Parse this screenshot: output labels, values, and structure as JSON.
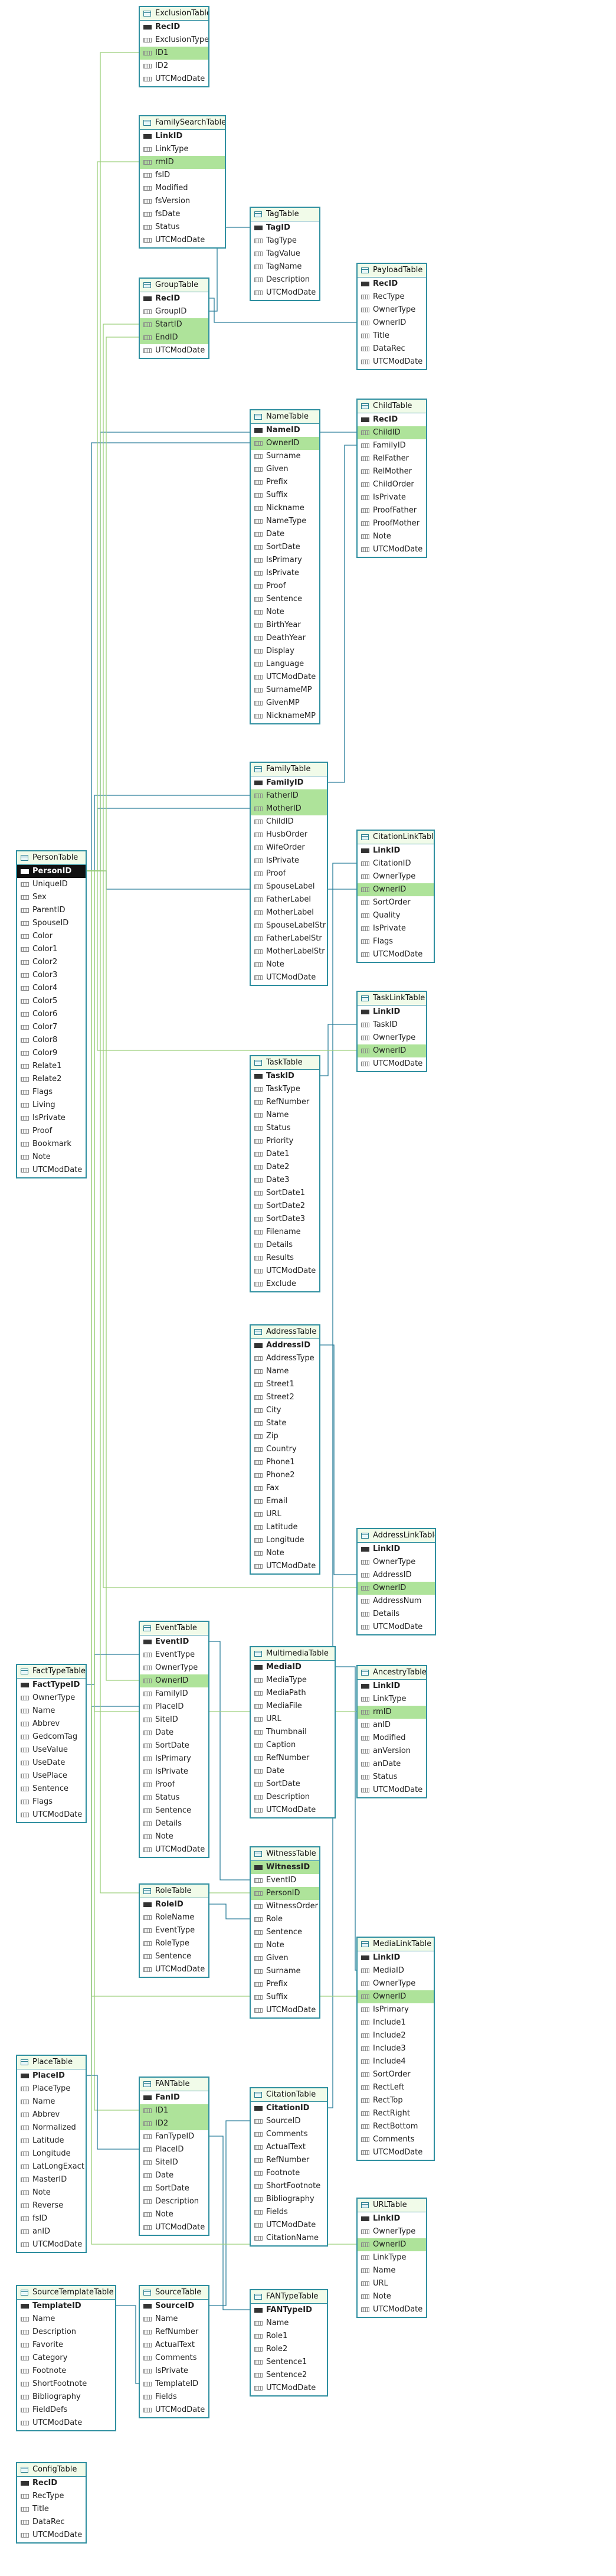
{
  "colors": {
    "border": "#2f8fa0",
    "title_bg": "#f1fbe9",
    "highlight": "#aee39a",
    "selected": "#111111",
    "link_blue": "#2a7e9a",
    "link_green": "#9ccf7a"
  },
  "icons": {
    "table": "table-icon",
    "field": "field-icon",
    "key": "key-icon"
  },
  "tables": [
    {
      "name": "ExclusionTable",
      "fields": [
        "RecID",
        "ExclusionType",
        "ID1",
        "ID2",
        "UTCModDate"
      ],
      "pk": [
        0
      ],
      "hl": [
        2
      ],
      "sel": []
    },
    {
      "name": "FamilySearchTable",
      "fields": [
        "LinkID",
        "LinkType",
        "rmID",
        "fsID",
        "Modified",
        "fsVersion",
        "fsDate",
        "Status",
        "UTCModDate"
      ],
      "pk": [
        0
      ],
      "hl": [
        2
      ],
      "sel": []
    },
    {
      "name": "TagTable",
      "fields": [
        "TagID",
        "TagType",
        "TagValue",
        "TagName",
        "Description",
        "UTCModDate"
      ],
      "pk": [
        0
      ],
      "hl": [],
      "sel": []
    },
    {
      "name": "GroupTable",
      "fields": [
        "RecID",
        "GroupID",
        "StartID",
        "EndID",
        "UTCModDate"
      ],
      "pk": [
        0
      ],
      "hl": [
        2,
        3
      ],
      "sel": []
    },
    {
      "name": "PayloadTable",
      "fields": [
        "RecID",
        "RecType",
        "OwnerType",
        "OwnerID",
        "Title",
        "DataRec",
        "UTCModDate"
      ],
      "pk": [
        0
      ],
      "hl": [],
      "sel": []
    },
    {
      "name": "ChildTable",
      "fields": [
        "RecID",
        "ChildID",
        "FamilyID",
        "RelFather",
        "RelMother",
        "ChildOrder",
        "IsPrivate",
        "ProofFather",
        "ProofMother",
        "Note",
        "UTCModDate"
      ],
      "pk": [
        0
      ],
      "hl": [
        1
      ],
      "sel": []
    },
    {
      "name": "NameTable",
      "fields": [
        "NameID",
        "OwnerID",
        "Surname",
        "Given",
        "Prefix",
        "Suffix",
        "Nickname",
        "NameType",
        "Date",
        "SortDate",
        "IsPrimary",
        "IsPrivate",
        "Proof",
        "Sentence",
        "Note",
        "BirthYear",
        "DeathYear",
        "Display",
        "Language",
        "UTCModDate",
        "SurnameMP",
        "GivenMP",
        "NicknameMP"
      ],
      "pk": [
        0
      ],
      "hl": [
        1
      ],
      "sel": []
    },
    {
      "name": "FamilyTable",
      "fields": [
        "FamilyID",
        "FatherID",
        "MotherID",
        "ChildID",
        "HusbOrder",
        "WifeOrder",
        "IsPrivate",
        "Proof",
        "SpouseLabel",
        "FatherLabel",
        "MotherLabel",
        "SpouseLabelStr",
        "FatherLabelStr",
        "MotherLabelStr",
        "Note",
        "UTCModDate"
      ],
      "pk": [
        0
      ],
      "hl": [
        1,
        2
      ],
      "sel": []
    },
    {
      "name": "PersonTable",
      "fields": [
        "PersonID",
        "UniqueID",
        "Sex",
        "ParentID",
        "SpouseID",
        "Color",
        "Color1",
        "Color2",
        "Color3",
        "Color4",
        "Color5",
        "Color6",
        "Color7",
        "Color8",
        "Color9",
        "Relate1",
        "Relate2",
        "Flags",
        "Living",
        "IsPrivate",
        "Proof",
        "Bookmark",
        "Note",
        "UTCModDate"
      ],
      "pk": [
        0
      ],
      "hl": [],
      "sel": [
        0
      ]
    },
    {
      "name": "CitationLinkTable",
      "fields": [
        "LinkID",
        "CitationID",
        "OwnerType",
        "OwnerID",
        "SortOrder",
        "Quality",
        "IsPrivate",
        "Flags",
        "UTCModDate"
      ],
      "pk": [
        0
      ],
      "hl": [
        3
      ],
      "sel": []
    },
    {
      "name": "TaskLinkTable",
      "fields": [
        "LinkID",
        "TaskID",
        "OwnerType",
        "OwnerID",
        "UTCModDate"
      ],
      "pk": [
        0
      ],
      "hl": [
        3
      ],
      "sel": []
    },
    {
      "name": "TaskTable",
      "fields": [
        "TaskID",
        "TaskType",
        "RefNumber",
        "Name",
        "Status",
        "Priority",
        "Date1",
        "Date2",
        "Date3",
        "SortDate1",
        "SortDate2",
        "SortDate3",
        "Filename",
        "Details",
        "Results",
        "UTCModDate",
        "Exclude"
      ],
      "pk": [
        0
      ],
      "hl": [],
      "sel": []
    },
    {
      "name": "AddressTable",
      "fields": [
        "AddressID",
        "AddressType",
        "Name",
        "Street1",
        "Street2",
        "City",
        "State",
        "Zip",
        "Country",
        "Phone1",
        "Phone2",
        "Fax",
        "Email",
        "URL",
        "Latitude",
        "Longitude",
        "Note",
        "UTCModDate"
      ],
      "pk": [
        0
      ],
      "hl": [],
      "sel": []
    },
    {
      "name": "AddressLinkTable",
      "fields": [
        "LinkID",
        "OwnerType",
        "AddressID",
        "OwnerID",
        "AddressNum",
        "Details",
        "UTCModDate"
      ],
      "pk": [
        0
      ],
      "hl": [
        3
      ],
      "sel": []
    },
    {
      "name": "FactTypeTable",
      "fields": [
        "FactTypeID",
        "OwnerType",
        "Name",
        "Abbrev",
        "GedcomTag",
        "UseValue",
        "UseDate",
        "UsePlace",
        "Sentence",
        "Flags",
        "UTCModDate"
      ],
      "pk": [
        0
      ],
      "hl": [],
      "sel": []
    },
    {
      "name": "EventTable",
      "fields": [
        "EventID",
        "EventType",
        "OwnerType",
        "OwnerID",
        "FamilyID",
        "PlaceID",
        "SiteID",
        "Date",
        "SortDate",
        "IsPrimary",
        "IsPrivate",
        "Proof",
        "Status",
        "Sentence",
        "Details",
        "Note",
        "UTCModDate"
      ],
      "pk": [
        0
      ],
      "hl": [
        3
      ],
      "sel": []
    },
    {
      "name": "MultimediaTable",
      "fields": [
        "MediaID",
        "MediaType",
        "MediaPath",
        "MediaFile",
        "URL",
        "Thumbnail",
        "Caption",
        "RefNumber",
        "Date",
        "SortDate",
        "Description",
        "UTCModDate"
      ],
      "pk": [
        0
      ],
      "hl": [],
      "sel": []
    },
    {
      "name": "AncestryTable",
      "fields": [
        "LinkID",
        "LinkType",
        "rmID",
        "anID",
        "Modified",
        "anVersion",
        "anDate",
        "Status",
        "UTCModDate"
      ],
      "pk": [
        0
      ],
      "hl": [
        2
      ],
      "sel": []
    },
    {
      "name": "WitnessTable",
      "fields": [
        "WitnessID",
        "EventID",
        "PersonID",
        "WitnessOrder",
        "Role",
        "Sentence",
        "Note",
        "Given",
        "Surname",
        "Prefix",
        "Suffix",
        "UTCModDate"
      ],
      "pk": [
        0
      ],
      "hl": [
        0,
        2
      ],
      "sel": []
    },
    {
      "name": "RoleTable",
      "fields": [
        "RoleID",
        "RoleName",
        "EventType",
        "RoleType",
        "Sentence",
        "UTCModDate"
      ],
      "pk": [
        0
      ],
      "hl": [],
      "sel": []
    },
    {
      "name": "MediaLinkTable",
      "fields": [
        "LinkID",
        "MediaID",
        "OwnerType",
        "OwnerID",
        "IsPrimary",
        "Include1",
        "Include2",
        "Include3",
        "Include4",
        "SortOrder",
        "RectLeft",
        "RectTop",
        "RectRight",
        "RectBottom",
        "Comments",
        "UTCModDate"
      ],
      "pk": [
        0
      ],
      "hl": [
        3
      ],
      "sel": []
    },
    {
      "name": "PlaceTable",
      "fields": [
        "PlaceID",
        "PlaceType",
        "Name",
        "Abbrev",
        "Normalized",
        "Latitude",
        "Longitude",
        "LatLongExact",
        "MasterID",
        "Note",
        "Reverse",
        "fsID",
        "anID",
        "UTCModDate"
      ],
      "pk": [
        0
      ],
      "hl": [],
      "sel": []
    },
    {
      "name": "FANTable",
      "fields": [
        "FanID",
        "ID1",
        "ID2",
        "FanTypeID",
        "PlaceID",
        "SiteID",
        "Date",
        "SortDate",
        "Description",
        "Note",
        "UTCModDate"
      ],
      "pk": [
        0
      ],
      "hl": [
        1,
        2
      ],
      "sel": []
    },
    {
      "name": "CitationTable",
      "fields": [
        "CitationID",
        "SourceID",
        "Comments",
        "ActualText",
        "RefNumber",
        "Footnote",
        "ShortFootnote",
        "Bibliography",
        "Fields",
        "UTCModDate",
        "CitationName"
      ],
      "pk": [
        0
      ],
      "hl": [],
      "sel": []
    },
    {
      "name": "URLTable",
      "fields": [
        "LinkID",
        "OwnerType",
        "OwnerID",
        "LinkType",
        "Name",
        "URL",
        "Note",
        "UTCModDate"
      ],
      "pk": [
        0
      ],
      "hl": [
        2
      ],
      "sel": []
    },
    {
      "name": "SourceTemplateTable",
      "fields": [
        "TemplateID",
        "Name",
        "Description",
        "Favorite",
        "Category",
        "Footnote",
        "ShortFootnote",
        "Bibliography",
        "FieldDefs",
        "UTCModDate"
      ],
      "pk": [
        0
      ],
      "hl": [],
      "sel": []
    },
    {
      "name": "SourceTable",
      "fields": [
        "SourceID",
        "Name",
        "RefNumber",
        "ActualText",
        "Comments",
        "IsPrivate",
        "TemplateID",
        "Fields",
        "UTCModDate"
      ],
      "pk": [
        0
      ],
      "hl": [],
      "sel": []
    },
    {
      "name": "FANTypeTable",
      "fields": [
        "FANTypeID",
        "Name",
        "Role1",
        "Role2",
        "Sentence1",
        "Sentence2",
        "UTCModDate"
      ],
      "pk": [
        0
      ],
      "hl": [],
      "sel": []
    },
    {
      "name": "ConfigTable",
      "fields": [
        "RecID",
        "RecType",
        "Title",
        "DataRec",
        "UTCModDate"
      ],
      "pk": [
        0
      ],
      "hl": [],
      "sel": []
    }
  ]
}
